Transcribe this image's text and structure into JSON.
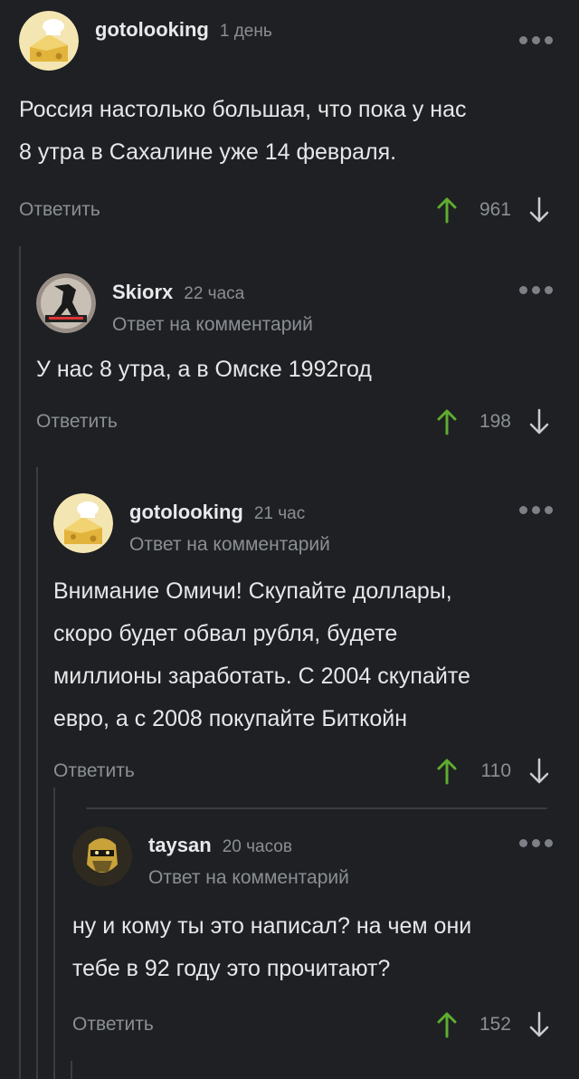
{
  "comments": [
    {
      "author": "gotolooking",
      "time": "1 день",
      "reply_label": "",
      "text_lines": [
        "Россия настолько большая, что пока у нас",
        "8 утра в Сахалине уже 14 февраля."
      ],
      "reply_action": "Ответить",
      "rating": "961",
      "avatar_icon": "cheese-avatar-icon"
    },
    {
      "author": "Skiorx",
      "time": "22 часа",
      "reply_label": "Ответ на комментарий",
      "text_lines": [
        "У нас 8 утра, а в Омске 1992год"
      ],
      "reply_action": "Ответить",
      "rating": "198",
      "avatar_icon": "rocknroll-avatar-icon"
    },
    {
      "author": "gotolooking",
      "time": "21 час",
      "reply_label": "Ответ на комментарий",
      "text_lines": [
        "Внимание Омичи! Скупайте доллары,",
        "скоро будет обвал рубля, будете",
        "миллионы заработать. С 2004 скупайте",
        "евро, а с 2008 покупайте Биткойн"
      ],
      "reply_action": "Ответить",
      "rating": "110",
      "avatar_icon": "cheese-avatar-icon"
    },
    {
      "author": "taysan",
      "time": "20 часов",
      "reply_label": "Ответ на комментарий",
      "text_lines": [
        "ну и кому ты это написал? на чем они",
        "тебе в 92 году это прочитают?"
      ],
      "reply_action": "Ответить",
      "rating": "152",
      "avatar_icon": "scorpion-avatar-icon"
    }
  ],
  "colors": {
    "background": "#1e2023",
    "upvote": "#5fad2f",
    "muted": "#8b8f94"
  }
}
